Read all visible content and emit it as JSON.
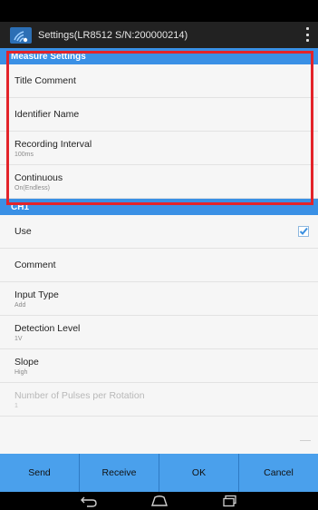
{
  "action_bar": {
    "title": "Settings(LR8512 S/N:200000214)",
    "app_icon": "wireless-logger-icon",
    "overflow_icon": "overflow-menu-icon"
  },
  "measure_section": {
    "header": "Measure Settings",
    "items": [
      {
        "title": "Title Comment",
        "summary": ""
      },
      {
        "title": "Identifier Name",
        "summary": ""
      },
      {
        "title": "Recording Interval",
        "summary": "100ms"
      },
      {
        "title": "Continuous",
        "summary": "On(Endless)"
      }
    ]
  },
  "ch1_section": {
    "header": "CH1",
    "use": {
      "title": "Use",
      "checked": true
    },
    "items": [
      {
        "title": "Comment",
        "summary": ""
      },
      {
        "title": "Input Type",
        "summary": "Add"
      },
      {
        "title": "Detection Level",
        "summary": "1V"
      },
      {
        "title": "Slope",
        "summary": "High"
      },
      {
        "title": "Number of Pulses per Rotation",
        "summary": "1",
        "disabled": true
      }
    ]
  },
  "buttons": {
    "send": "Send",
    "receive": "Receive",
    "ok": "OK",
    "cancel": "Cancel"
  },
  "nav": {
    "back_icon": "back-icon",
    "home_icon": "home-icon",
    "recents_icon": "recent-apps-icon"
  },
  "colors": {
    "accent": "#3a90e5",
    "button": "#4aa0ec",
    "highlight": "#e3232a",
    "checkbox": "#3a8fe0"
  }
}
